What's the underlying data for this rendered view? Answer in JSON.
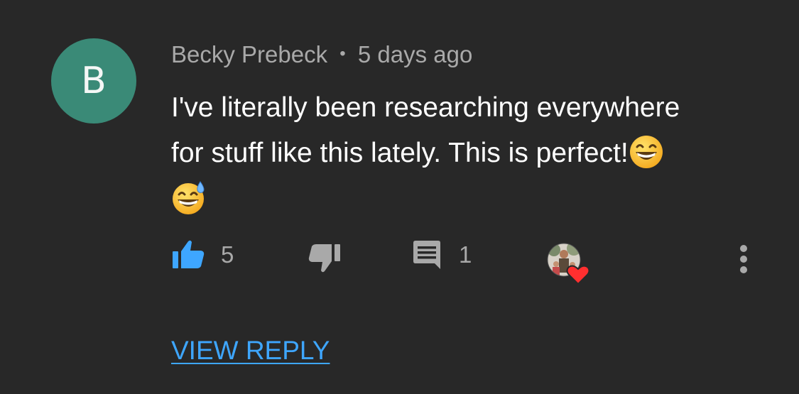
{
  "comment": {
    "avatar_letter": "B",
    "author": "Becky Prebeck",
    "separator": "•",
    "timestamp": "5 days ago",
    "text_line_1": "I've literally been researching everywhere",
    "text_line_2": "for stuff like this lately.  This is perfect!",
    "emojis": [
      "grinning-face-emoji",
      "sweat-smile-emoji"
    ]
  },
  "actions": {
    "like_count": "5",
    "reply_count": "1",
    "liked": true,
    "creator_hearted": true
  },
  "view_reply_label": "VIEW REPLY",
  "colors": {
    "background": "#282828",
    "avatar": "#3a8a77",
    "like_active": "#3ea6ff",
    "link": "#3ea6ff",
    "muted_text": "#a9a9a9",
    "heart": "#ff2f2f"
  }
}
